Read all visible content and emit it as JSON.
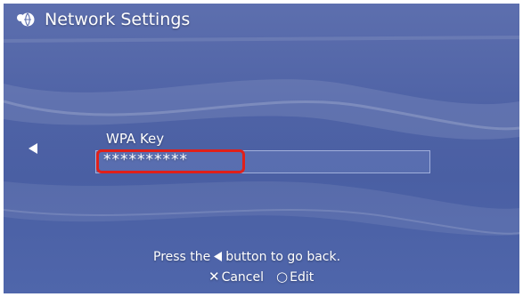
{
  "window": {
    "title": "Network Settings",
    "title_icon": "network-globe-icon"
  },
  "form": {
    "field_label": "WPA Key",
    "field_value": "**********",
    "highlight_color": "#e0201a"
  },
  "footer": {
    "hint_prefix": "Press the",
    "hint_suffix": "button to go back.",
    "cancel_glyph": "✕",
    "cancel_label": "Cancel",
    "edit_glyph": "○",
    "edit_label": "Edit"
  },
  "colors": {
    "background": "#4f63a6",
    "text": "#ffffff"
  }
}
